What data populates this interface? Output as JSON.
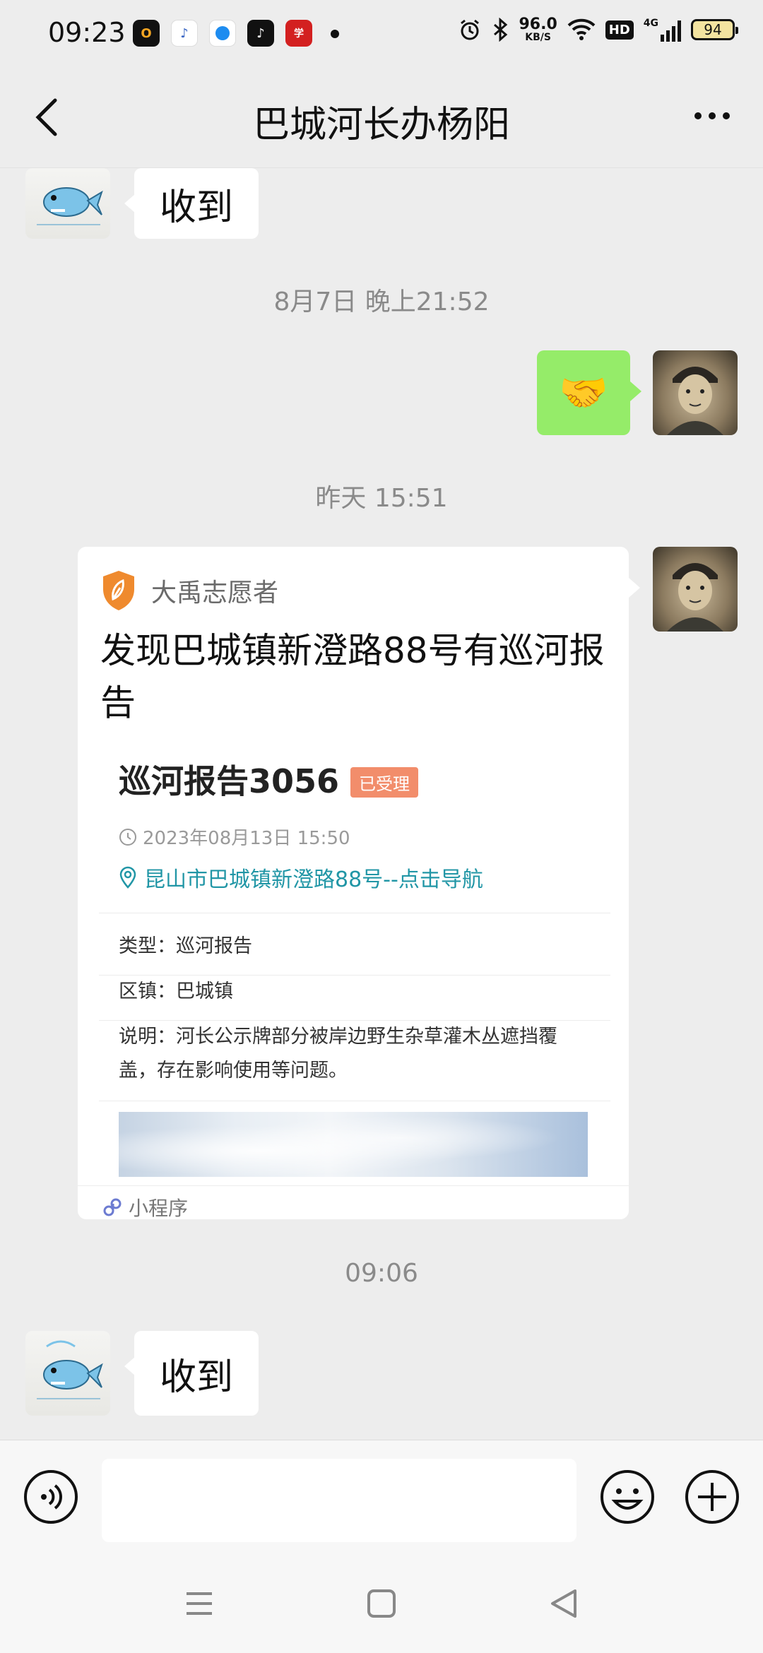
{
  "status_bar": {
    "time": "09:23",
    "app_icons": [
      "office-app",
      "steps-app",
      "browser-app",
      "tiktok-app",
      "study-app"
    ],
    "net_speed_value": "96.0",
    "net_speed_unit": "KB/S",
    "hd_label": "HD",
    "signal_label": "4G",
    "battery": "94"
  },
  "header": {
    "title": "巴城河长办杨阳"
  },
  "messages": {
    "msg1_text": "收到",
    "ts1": "8月7日 晚上21:52",
    "msg2_emoji": "🤝",
    "ts2": "昨天 15:51",
    "ts3": "09:06",
    "msg4_text": "收到"
  },
  "card": {
    "source_name": "大禹志愿者",
    "title": "发现巴城镇新澄路88号有巡河报告",
    "report_title": "巡河报告3056",
    "status_badge": "已受理",
    "datetime": "2023年08月13日 15:50",
    "location": "昆山市巴城镇新澄路88号--点击导航",
    "type_label": "类型：",
    "type_value": "巡河报告",
    "town_label": "区镇：",
    "town_value": "巴城镇",
    "desc_label": "说明：",
    "desc_value": "河长公示牌部分被岸边野生杂草灌木丛遮挡覆盖，存在影响使用等问题。",
    "footer_label": "小程序"
  },
  "input": {
    "placeholder": ""
  },
  "colors": {
    "accent_green": "#95ec69",
    "badge_orange": "#f28d6b",
    "link_teal": "#2196a6",
    "source_orange": "#ef8a2e"
  }
}
